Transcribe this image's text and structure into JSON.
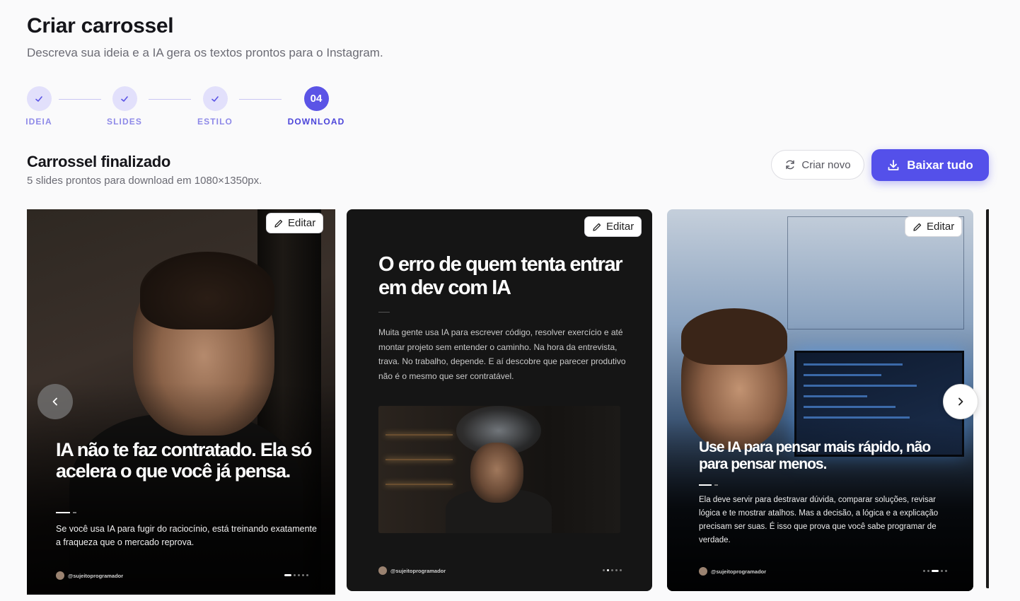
{
  "header": {
    "title": "Criar carrossel",
    "subtitle": "Descreva sua ideia e a IA gera os textos prontos para o Instagram."
  },
  "stepper": {
    "steps": [
      {
        "label": "IDEIA",
        "state": "done"
      },
      {
        "label": "SLIDES",
        "state": "done"
      },
      {
        "label": "ESTILO",
        "state": "done"
      },
      {
        "label": "DOWNLOAD",
        "state": "active",
        "number": "04"
      }
    ]
  },
  "section": {
    "title": "Carrossel finalizado",
    "subtitle": "5 slides prontos para download em 1080×1350px."
  },
  "actions": {
    "new_label": "Criar novo",
    "download_label": "Baixar tudo"
  },
  "colors": {
    "accent": "#5450ea",
    "step_done_bg": "#e2e0fb"
  },
  "slides": [
    {
      "edit_label": "Editar",
      "headline": "IA não te faz contratado. Ela só acelera o que você já pensa.",
      "body": "Se você usa IA para fugir do raciocínio, está treinando exatamente a fraqueza que o mercado reprova.",
      "handle": "@sujeitoprogramador",
      "active_dot": 1,
      "dot_count": 5
    },
    {
      "edit_label": "Editar",
      "headline": "O erro de quem tenta entrar em dev com IA",
      "body": "Muita gente usa IA para escrever código, resolver exercício e até montar projeto sem entender o caminho. Na hora da entrevista, trava. No trabalho, depende. E aí descobre que parecer produtivo não é o mesmo que ser contratável.",
      "handle": "@sujeitoprogramador",
      "active_dot": 2,
      "dot_count": 5
    },
    {
      "edit_label": "Editar",
      "headline": "Use IA para pensar mais rápido, não para pensar menos.",
      "body": "Ela deve servir para destravar dúvida, comparar soluções, revisar lógica e te mostrar atalhos. Mas a decisão, a lógica e a explicação precisam ser suas. É isso que prova que você sabe programar de verdade.",
      "handle": "@sujeitoprogramador",
      "active_dot": 3,
      "dot_count": 5
    }
  ],
  "icons": {
    "check": "check-icon",
    "refresh": "refresh-icon",
    "download": "download-icon",
    "pencil": "pencil-icon",
    "prev": "chevron-left-icon",
    "next": "chevron-right-icon"
  }
}
